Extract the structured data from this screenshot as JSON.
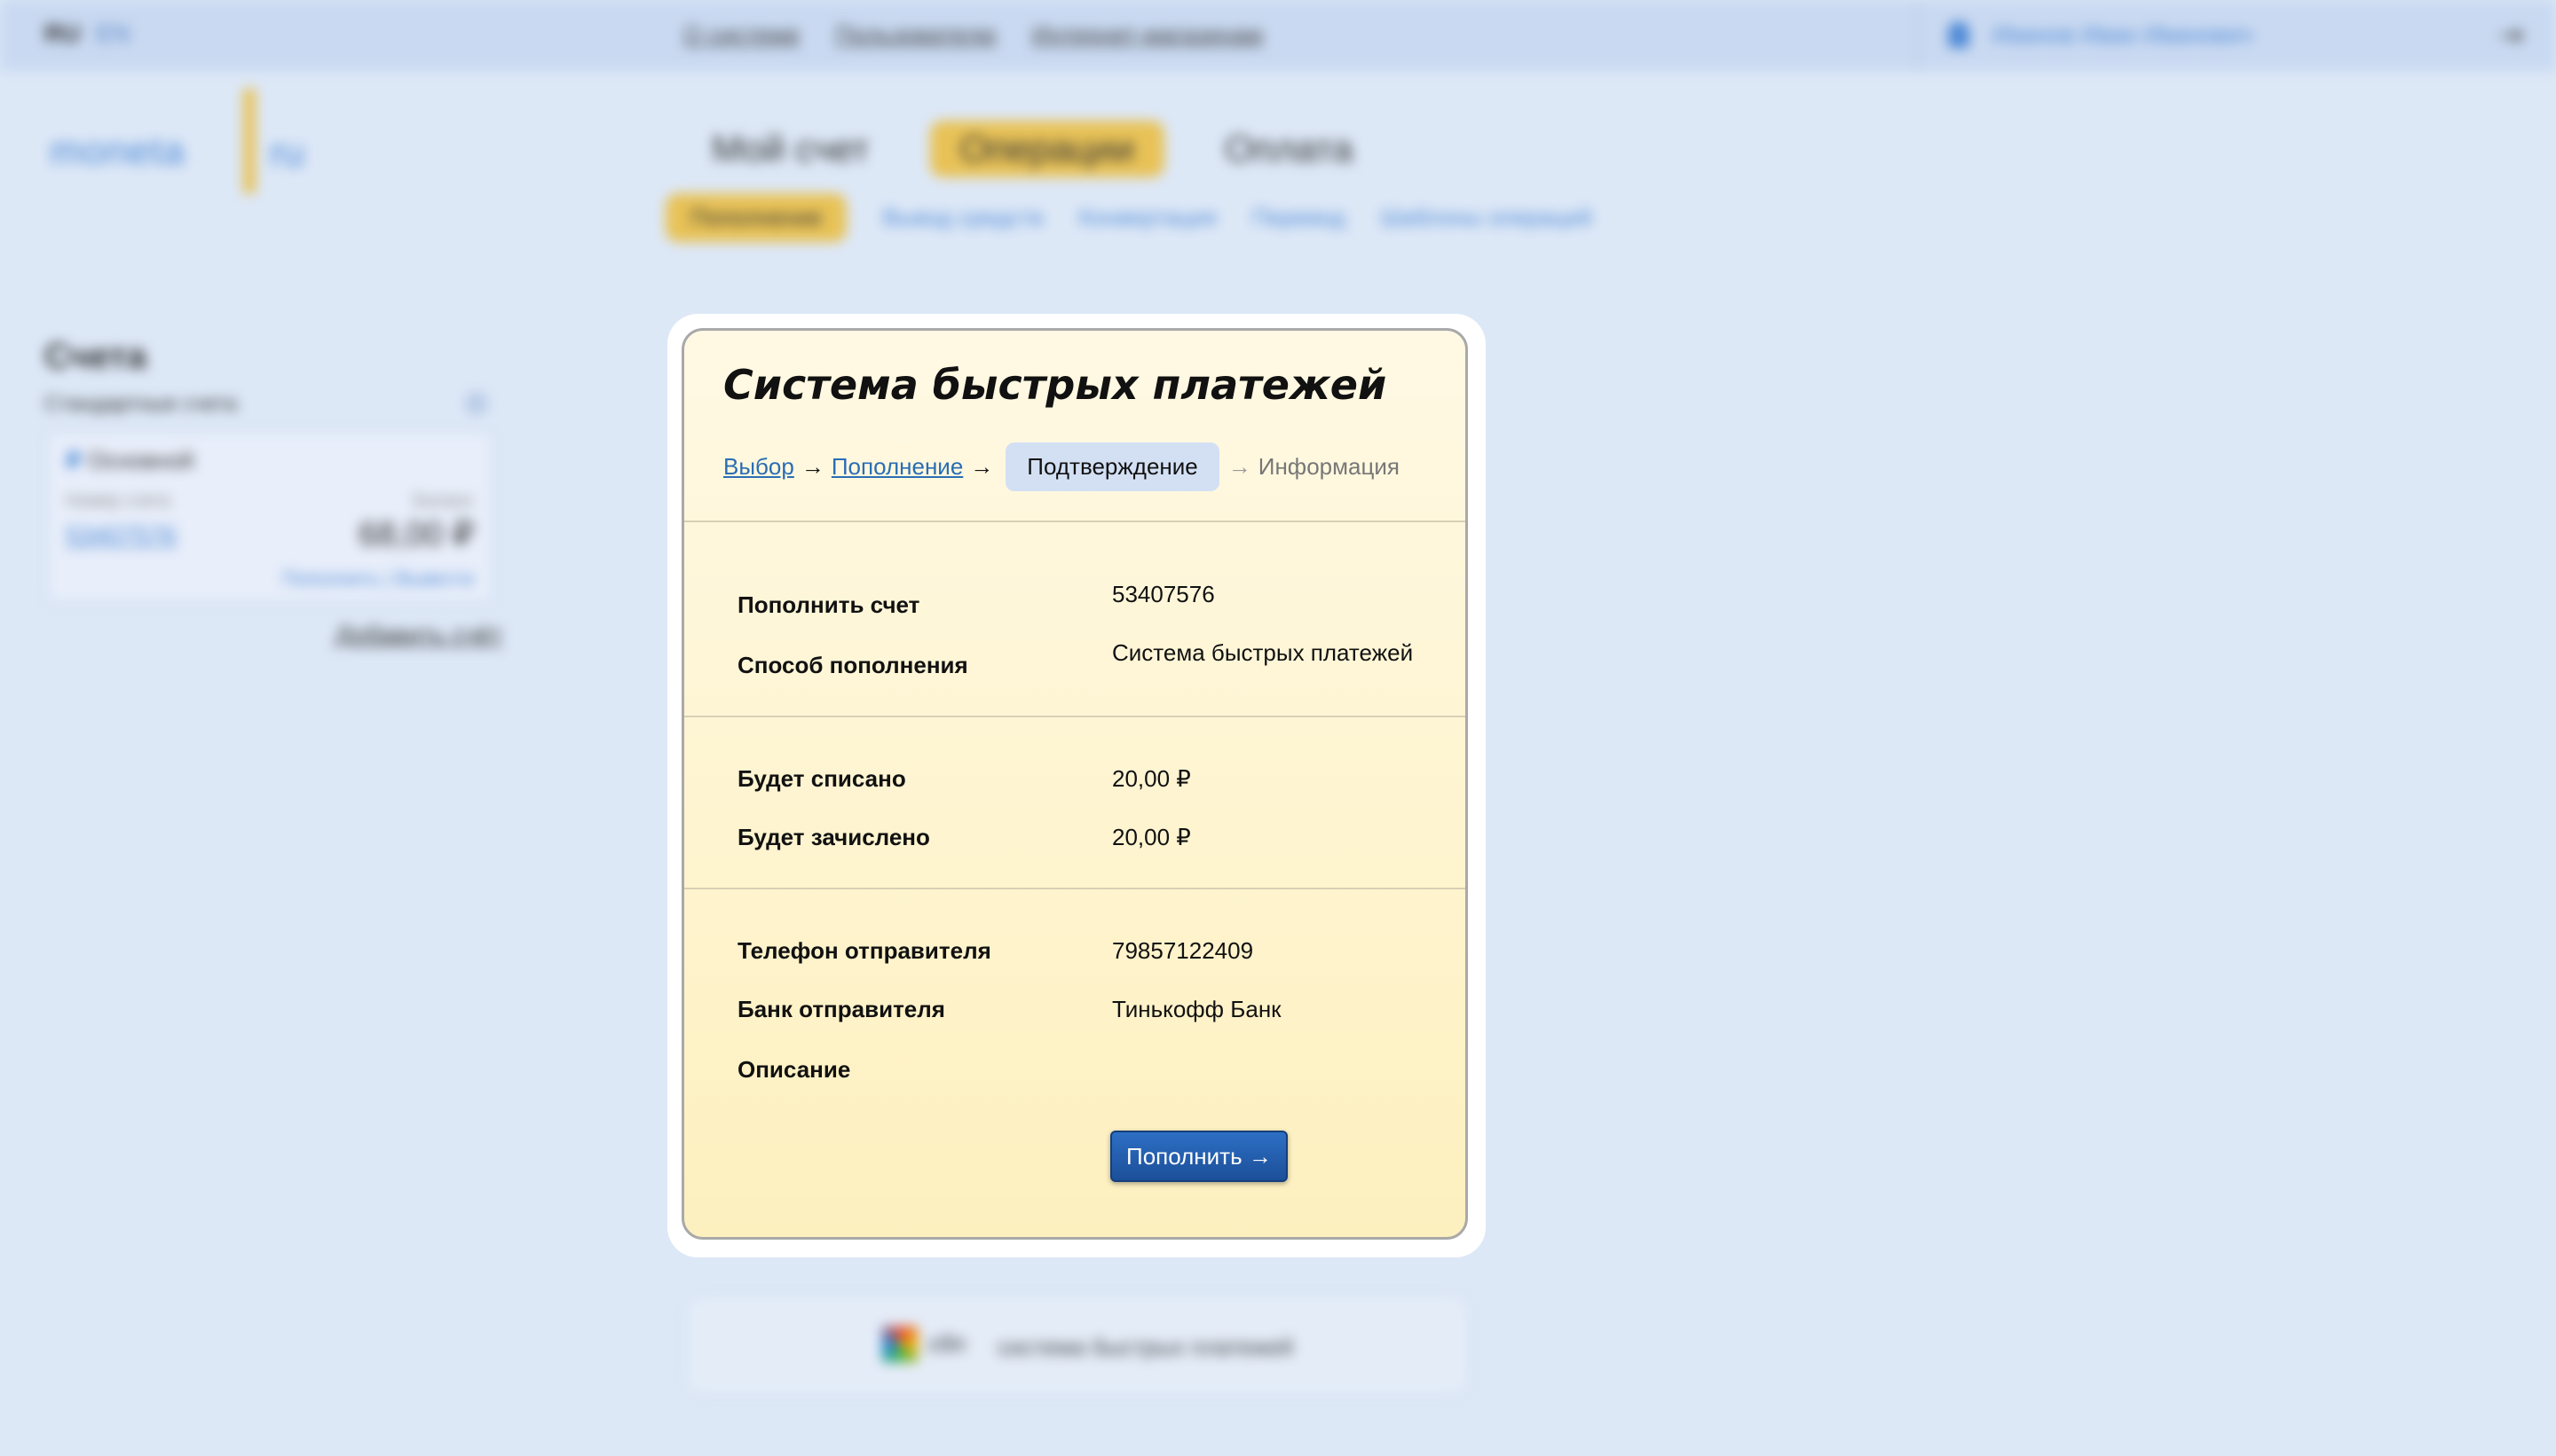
{
  "background": {
    "lang_ru": "RU",
    "lang_en": "EN",
    "top_nav": [
      "О системе",
      "Пользователю",
      "Интернет-магазинам"
    ],
    "user_name": "Иванов Иван Иванович",
    "logo_text": "moneta",
    "logo_ru": "ru",
    "main_tabs": [
      "Мой счет",
      "Операции",
      "Оплата"
    ],
    "sub_tabs": [
      "Пополнение",
      "Вывод средств",
      "Конвертация",
      "Перевод",
      "Шаблоны операций"
    ],
    "sidebar_title": "Счета",
    "sidebar_subtitle": "Стандартные счета",
    "account_name": "Основной",
    "account_number_label": "Номер счета",
    "account_balance_label": "Баланс",
    "account_number": "53407576",
    "account_balance": "68,00 ₽",
    "account_links": "Пополнить | Вывести",
    "add_account": "Добавить счёт",
    "sbp_logo_text": "сбп",
    "sbp_text": "система быстрых платежей"
  },
  "modal": {
    "title": "Система быстрых платежей",
    "steps": {
      "step1": "Выбор",
      "step2": "Пополнение",
      "current": "Подтверждение",
      "future": "Информация",
      "arrow": "→"
    },
    "rows": {
      "account_label": "Пополнить счет",
      "account_value": "53407576",
      "method_label": "Способ пополнения",
      "method_value": "Система быстрых платежей",
      "debit_label": "Будет списано",
      "debit_value": "20,00 ₽",
      "credit_label": "Будет зачислено",
      "credit_value": "20,00 ₽",
      "phone_label": "Телефон отправителя",
      "phone_value": "79857122409",
      "bank_label": "Банк отправителя",
      "bank_value": "Тинькофф Банк",
      "description_label": "Описание",
      "description_value": ""
    },
    "submit_label": "Пополнить →"
  }
}
